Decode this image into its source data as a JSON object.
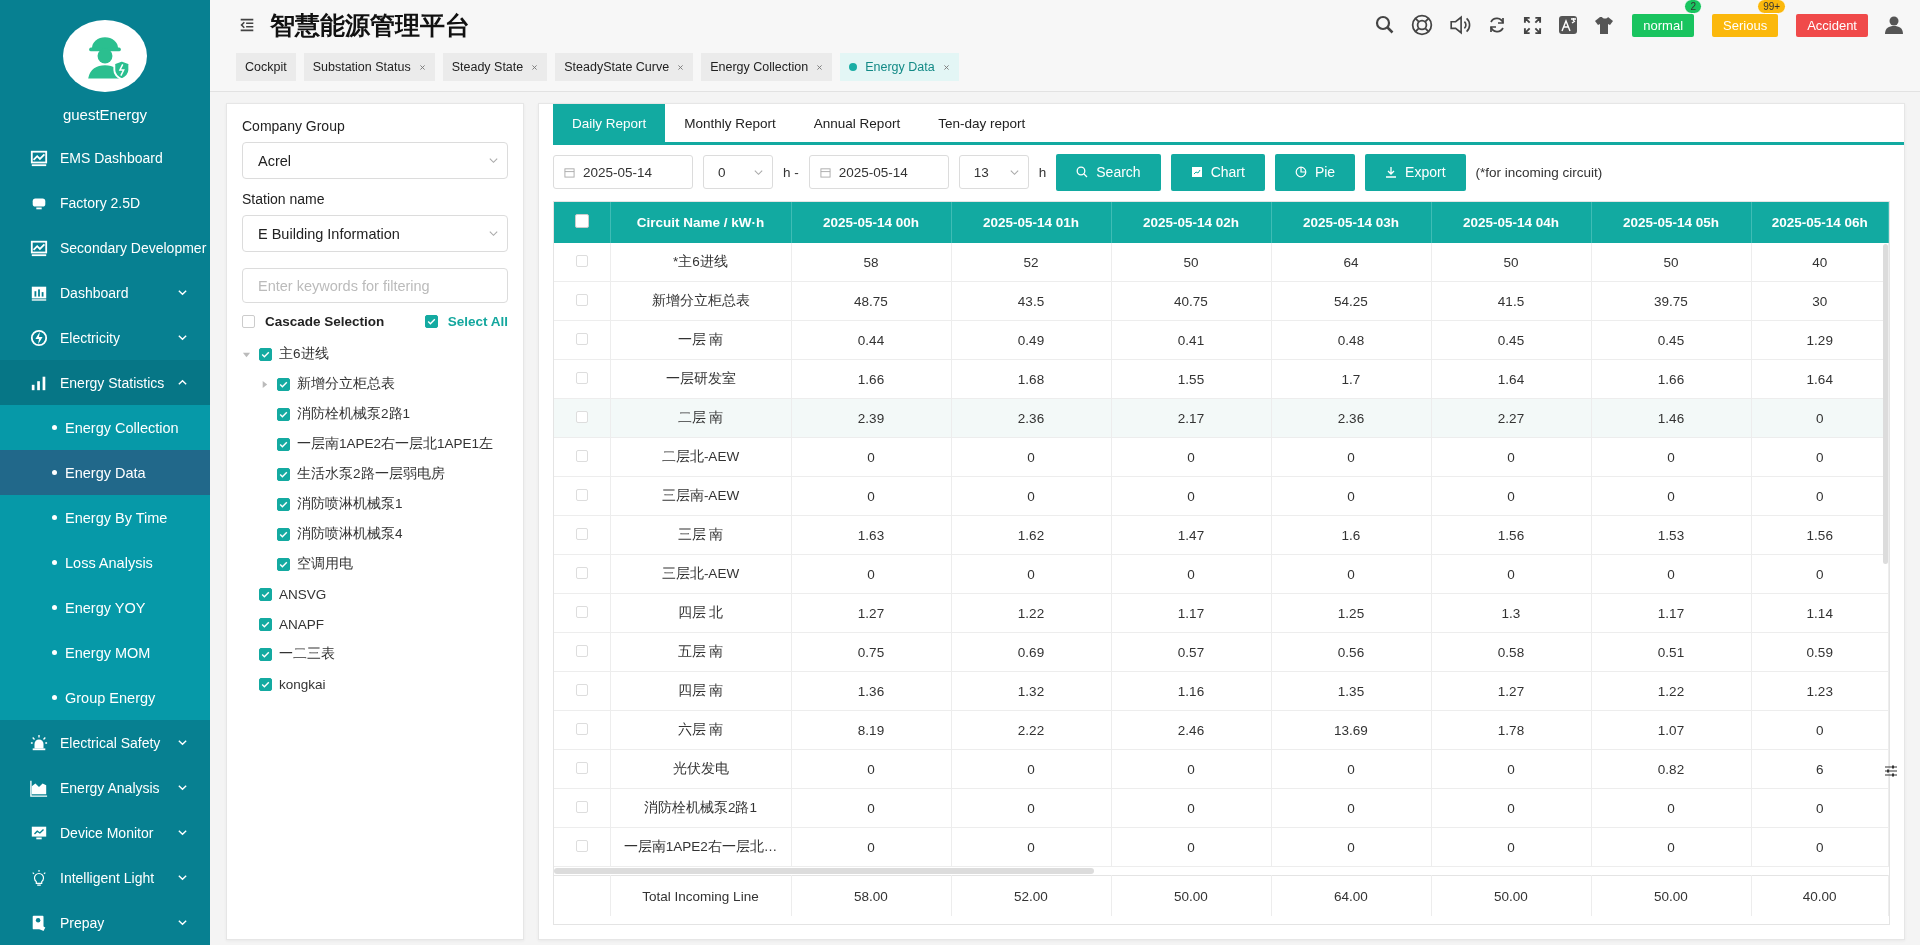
{
  "sidebar": {
    "user": "guestEnergy",
    "items": [
      {
        "label": "EMS Dashboard",
        "kind": "menu"
      },
      {
        "label": "Factory 2.5D",
        "kind": "menu"
      },
      {
        "label": "Secondary Developmer",
        "kind": "menu"
      },
      {
        "label": "Dashboard",
        "kind": "menu",
        "expanded": false
      },
      {
        "label": "Electricity",
        "kind": "menu",
        "expanded": false
      },
      {
        "label": "Energy Statistics",
        "kind": "menu",
        "expanded": true
      },
      {
        "label": "Energy Collection",
        "kind": "sub",
        "selected": false
      },
      {
        "label": "Energy Data",
        "kind": "sub",
        "selected": true
      },
      {
        "label": "Energy By Time",
        "kind": "sub",
        "selected": false
      },
      {
        "label": "Loss Analysis",
        "kind": "sub",
        "selected": false
      },
      {
        "label": "Energy YOY",
        "kind": "sub",
        "selected": false
      },
      {
        "label": "Energy MOM",
        "kind": "sub",
        "selected": false
      },
      {
        "label": "Group Energy",
        "kind": "sub",
        "selected": false
      },
      {
        "label": "Electrical Safety",
        "kind": "menu",
        "expanded": false
      },
      {
        "label": "Energy Analysis",
        "kind": "menu",
        "expanded": false
      },
      {
        "label": "Device Monitor",
        "kind": "menu",
        "expanded": false
      },
      {
        "label": "Intelligent Light",
        "kind": "menu",
        "expanded": false
      },
      {
        "label": "Prepay",
        "kind": "menu",
        "expanded": false
      }
    ]
  },
  "header": {
    "title": "智慧能源管理平台",
    "alarms": [
      {
        "label": "normal",
        "count": "2",
        "color": "#19c45f"
      },
      {
        "label": "Serious",
        "count": "99+",
        "color": "#fbb80c"
      },
      {
        "label": "Accident",
        "color": "#f04a4a"
      }
    ]
  },
  "tabs": [
    {
      "label": "Cockpit",
      "closable": false,
      "selected": false
    },
    {
      "label": "Substation Status",
      "closable": true,
      "selected": false
    },
    {
      "label": "Steady State",
      "closable": true,
      "selected": false
    },
    {
      "label": "SteadyState Curve",
      "closable": true,
      "selected": false
    },
    {
      "label": "Energy Collection",
      "closable": true,
      "selected": false
    },
    {
      "label": "Energy Data",
      "closable": true,
      "selected": true
    }
  ],
  "filter": {
    "company_label": "Company Group",
    "company": "Acrel",
    "station_label": "Station name",
    "station": "E Building Information",
    "search_placeholder": "Enter keywords for filtering",
    "cascade": {
      "label": "Cascade Selection",
      "checked": false
    },
    "select_all": {
      "label": "Select All",
      "checked": true
    },
    "tree": [
      {
        "label": "主6进线",
        "checked": true,
        "expanded": true,
        "children": [
          {
            "label": "新增分立柜总表",
            "checked": true,
            "expanded": false
          },
          {
            "label": "消防栓机械泵2路1",
            "checked": true
          },
          {
            "label": "一层南1APE2右一层北1APE1左",
            "checked": true
          },
          {
            "label": "生活水泵2路一层弱电房",
            "checked": true
          },
          {
            "label": "消防喷淋机械泵1",
            "checked": true
          },
          {
            "label": "消防喷淋机械泵4",
            "checked": true
          },
          {
            "label": "空调用电",
            "checked": true
          }
        ]
      },
      {
        "label": "ANSVG",
        "checked": true
      },
      {
        "label": "ANAPF",
        "checked": true
      },
      {
        "label": "一二三表",
        "checked": true
      },
      {
        "label": "kongkai",
        "checked": true
      }
    ]
  },
  "report_tabs": [
    {
      "label": "Daily Report",
      "selected": true
    },
    {
      "label": "Monthly Report",
      "selected": false
    },
    {
      "label": "Annual Report",
      "selected": false
    },
    {
      "label": "Ten-day report",
      "selected": false
    }
  ],
  "toolbar": {
    "start_date": "2025-05-14",
    "start_hour": "0",
    "separator": "h -",
    "end_date": "2025-05-14",
    "end_hour": "13",
    "hour_unit": "h",
    "buttons": [
      {
        "label": "Search",
        "kind": "search"
      },
      {
        "label": "Chart",
        "kind": "chart"
      },
      {
        "label": "Pie",
        "kind": "pie"
      },
      {
        "label": "Export",
        "kind": "export"
      }
    ],
    "note": "(*for incoming circuit)"
  },
  "table": {
    "header_checked": false,
    "columns": [
      "Circuit Name / kW·h",
      "2025-05-14 00h",
      "2025-05-14 01h",
      "2025-05-14 02h",
      "2025-05-14 03h",
      "2025-05-14 04h",
      "2025-05-14 05h",
      "2025-05-14 06h"
    ],
    "rows": [
      {
        "checked": false,
        "highlighted": false,
        "cells": [
          "*主6进线",
          "58",
          "52",
          "50",
          "64",
          "50",
          "50",
          "40"
        ]
      },
      {
        "checked": false,
        "highlighted": false,
        "cells": [
          "新增分立柜总表",
          "48.75",
          "43.5",
          "40.75",
          "54.25",
          "41.5",
          "39.75",
          "30"
        ]
      },
      {
        "checked": false,
        "highlighted": false,
        "cells": [
          "一层 南",
          "0.44",
          "0.49",
          "0.41",
          "0.48",
          "0.45",
          "0.45",
          "1.29"
        ]
      },
      {
        "checked": false,
        "highlighted": false,
        "cells": [
          "一层研发室",
          "1.66",
          "1.68",
          "1.55",
          "1.7",
          "1.64",
          "1.66",
          "1.64"
        ]
      },
      {
        "checked": false,
        "highlighted": true,
        "cells": [
          "二层 南",
          "2.39",
          "2.36",
          "2.17",
          "2.36",
          "2.27",
          "1.46",
          "0"
        ]
      },
      {
        "checked": false,
        "highlighted": false,
        "cells": [
          "二层北-AEW",
          "0",
          "0",
          "0",
          "0",
          "0",
          "0",
          "0"
        ]
      },
      {
        "checked": false,
        "highlighted": false,
        "cells": [
          "三层南-AEW",
          "0",
          "0",
          "0",
          "0",
          "0",
          "0",
          "0"
        ]
      },
      {
        "checked": false,
        "highlighted": false,
        "cells": [
          "三层 南",
          "1.63",
          "1.62",
          "1.47",
          "1.6",
          "1.56",
          "1.53",
          "1.56"
        ]
      },
      {
        "checked": false,
        "highlighted": false,
        "cells": [
          "三层北-AEW",
          "0",
          "0",
          "0",
          "0",
          "0",
          "0",
          "0"
        ]
      },
      {
        "checked": false,
        "highlighted": false,
        "cells": [
          "四层 北",
          "1.27",
          "1.22",
          "1.17",
          "1.25",
          "1.3",
          "1.17",
          "1.14"
        ]
      },
      {
        "checked": false,
        "highlighted": false,
        "cells": [
          "五层 南",
          "0.75",
          "0.69",
          "0.57",
          "0.56",
          "0.58",
          "0.51",
          "0.59"
        ]
      },
      {
        "checked": false,
        "highlighted": false,
        "cells": [
          "四层 南",
          "1.36",
          "1.32",
          "1.16",
          "1.35",
          "1.27",
          "1.22",
          "1.23"
        ]
      },
      {
        "checked": false,
        "highlighted": false,
        "cells": [
          "六层 南",
          "8.19",
          "2.22",
          "2.46",
          "13.69",
          "1.78",
          "1.07",
          "0"
        ]
      },
      {
        "checked": false,
        "highlighted": false,
        "cells": [
          "光伏发电",
          "0",
          "0",
          "0",
          "0",
          "0",
          "0.82",
          "6"
        ]
      },
      {
        "checked": false,
        "highlighted": false,
        "cells": [
          "消防栓机械泵2路1",
          "0",
          "0",
          "0",
          "0",
          "0",
          "0",
          "0"
        ]
      },
      {
        "checked": false,
        "highlighted": false,
        "cells": [
          "一层南1APE2右一层北…",
          "0",
          "0",
          "0",
          "0",
          "0",
          "0",
          "0"
        ]
      }
    ],
    "total": [
      "Total Incoming Line",
      "58.00",
      "52.00",
      "50.00",
      "64.00",
      "50.00",
      "50.00",
      "40.00"
    ]
  }
}
